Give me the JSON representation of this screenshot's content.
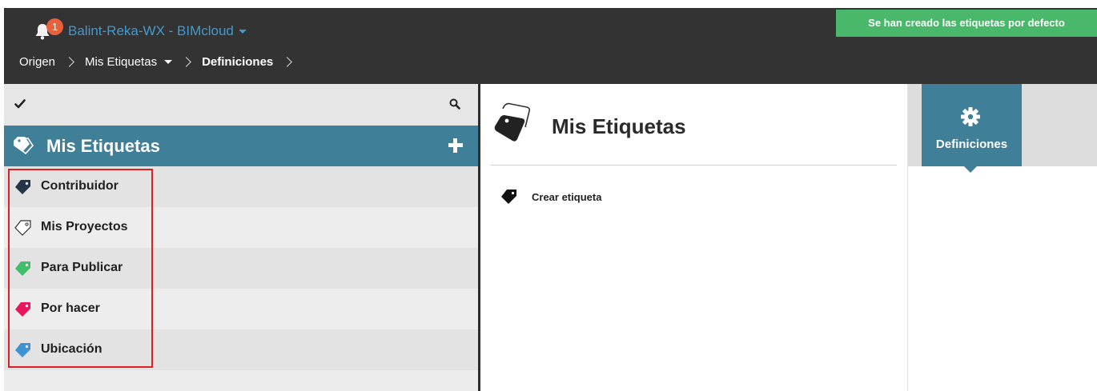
{
  "header": {
    "notification_count": "1",
    "server_title": "Balint-Reka-WX - BIMcloud",
    "breadcrumb": [
      "Origen",
      "Mis Etiquetas",
      "Definiciones"
    ]
  },
  "notice": {
    "text": "Se han creado las etiquetas por defecto",
    "color": "#49b86a"
  },
  "sidebar": {
    "title": "Mis Etiquetas",
    "accent_color": "#3f7f97",
    "tags": [
      {
        "label": "Contribuidor",
        "color": "#263447",
        "icon": "tag-filled-icon"
      },
      {
        "label": "Mis Proyectos",
        "color": "#ffffff",
        "icon": "tag-outline-icon"
      },
      {
        "label": "Para Publicar",
        "color": "#3fbf6a",
        "icon": "tag-filled-icon"
      },
      {
        "label": "Por hacer",
        "color": "#e8175d",
        "icon": "tag-filled-icon"
      },
      {
        "label": "Ubicación",
        "color": "#3d93d4",
        "icon": "tag-filled-icon"
      }
    ]
  },
  "main": {
    "title": "Mis Etiquetas",
    "create_label": "Crear etiqueta"
  },
  "right_panel": {
    "tab_label": "Definiciones",
    "icon": "gear-icon"
  }
}
